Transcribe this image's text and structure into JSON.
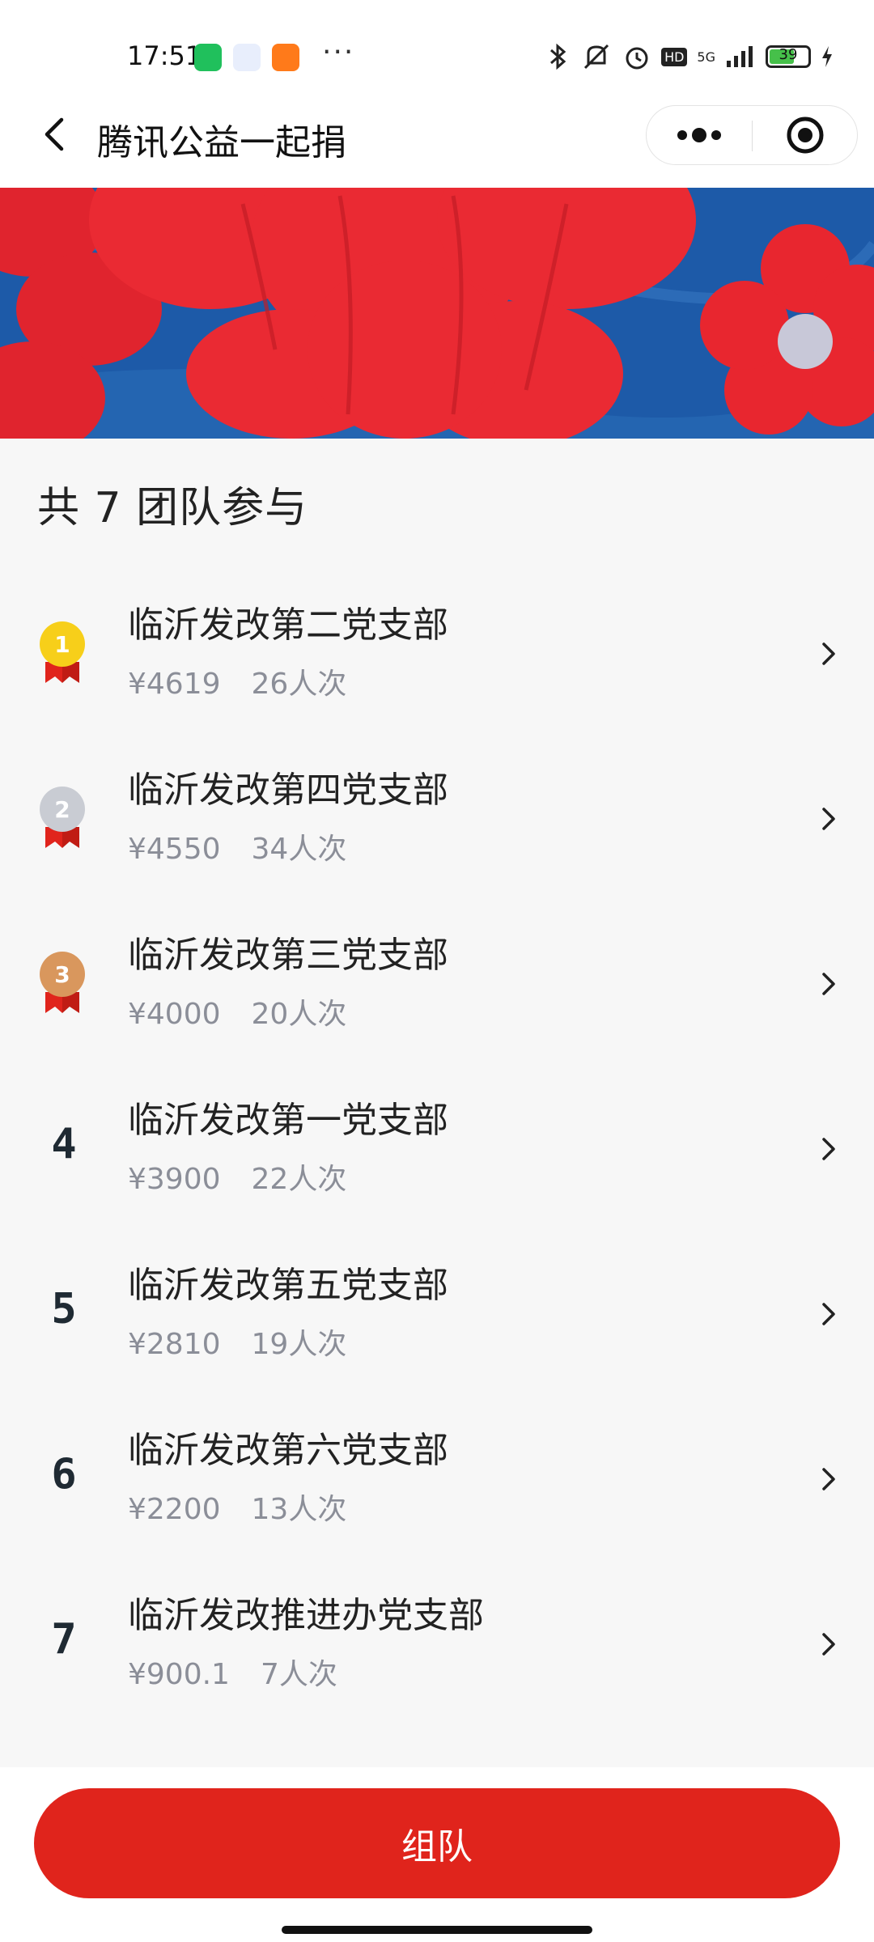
{
  "status_bar": {
    "time": "17:51",
    "more_indicator": "···",
    "battery": "39",
    "network": "5G",
    "hd_label": "HD",
    "icons": [
      "wechat-icon",
      "video-app-icon",
      "taobao-icon",
      "bluetooth-icon",
      "mute-icon",
      "alarm-icon",
      "hd-icon",
      "signal-icon",
      "battery-icon",
      "charging-icon"
    ]
  },
  "nav": {
    "title": "腾讯公益一起捐",
    "back_icon": "back-arrow-icon",
    "more_icon": "more-dots-icon",
    "close_icon": "close-target-icon"
  },
  "banner": {
    "bg_color": "#1f5fae",
    "flower_color": "#e82a32",
    "center_color": "#c8c8d8"
  },
  "summary": {
    "title": "共 7 团队参与"
  },
  "teams": [
    {
      "rank": "1",
      "name": "临沂发改第二党支部",
      "amount": "¥4619",
      "people": "26人次",
      "medal": "gold"
    },
    {
      "rank": "2",
      "name": "临沂发改第四党支部",
      "amount": "¥4550",
      "people": "34人次",
      "medal": "silver"
    },
    {
      "rank": "3",
      "name": "临沂发改第三党支部",
      "amount": "¥4000",
      "people": "20人次",
      "medal": "bronze"
    },
    {
      "rank": "4",
      "name": "临沂发改第一党支部",
      "amount": "¥3900",
      "people": "22人次",
      "medal": ""
    },
    {
      "rank": "5",
      "name": "临沂发改第五党支部",
      "amount": "¥2810",
      "people": "19人次",
      "medal": ""
    },
    {
      "rank": "6",
      "name": "临沂发改第六党支部",
      "amount": "¥2200",
      "people": "13人次",
      "medal": ""
    },
    {
      "rank": "7",
      "name": "临沂发改推进办党支部",
      "amount": "¥900.1",
      "people": "7人次",
      "medal": ""
    }
  ],
  "colors": {
    "gold": "#f7cf1a",
    "silver": "#c9ccd3",
    "bronze": "#d9975d",
    "ribbon": "#e0241c",
    "accent": "#e0241c"
  },
  "action": {
    "team_up_label": "组队"
  }
}
